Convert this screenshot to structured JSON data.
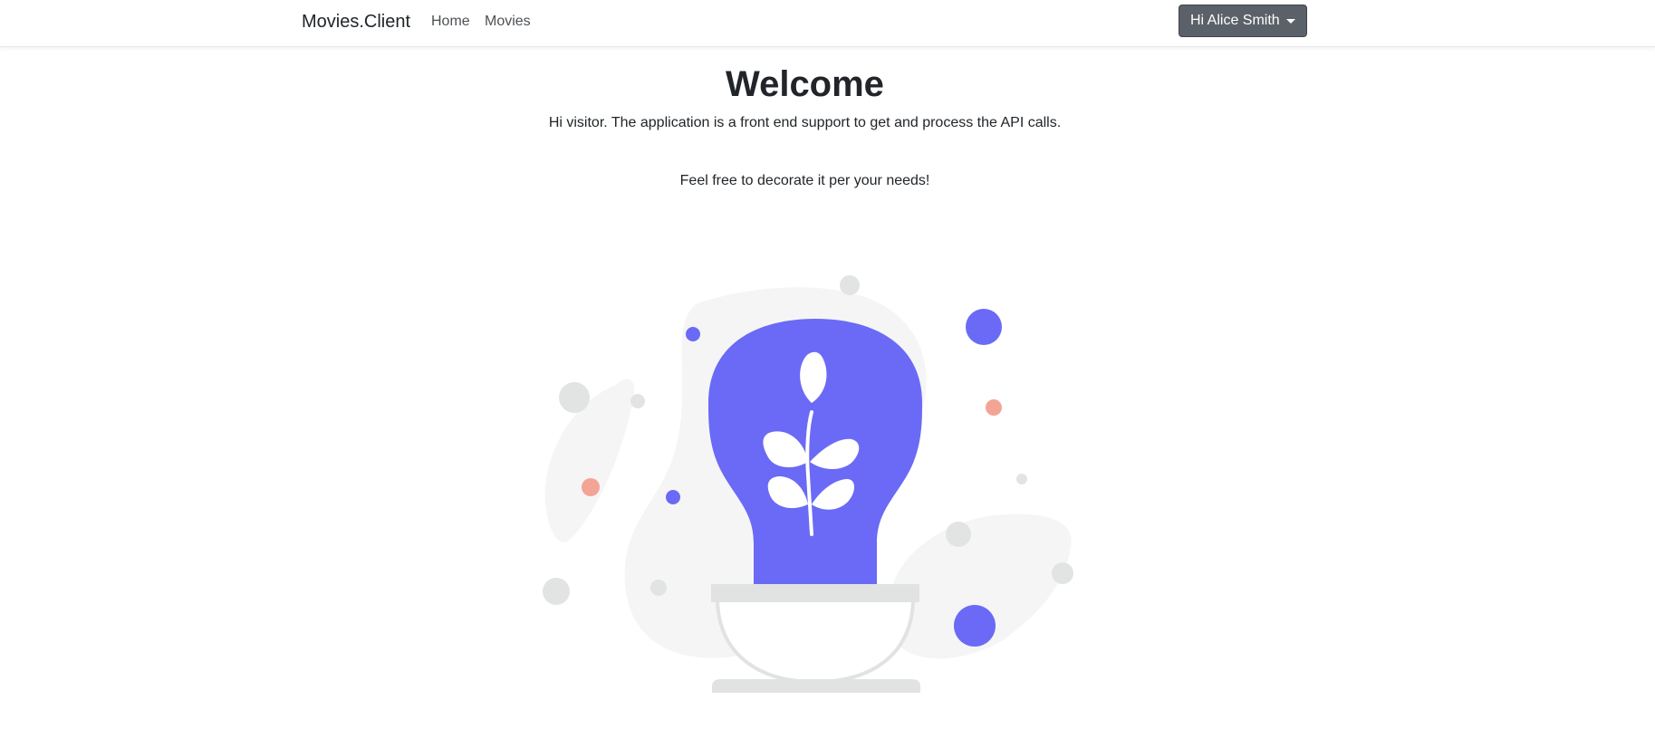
{
  "navbar": {
    "brand": "Movies.Client",
    "links": [
      {
        "label": "Home"
      },
      {
        "label": "Movies"
      }
    ],
    "user_menu_label": "Hi Alice Smith"
  },
  "main": {
    "title": "Welcome",
    "intro": "Hi visitor. The application is a front end support to get and process the API calls.",
    "note": "Feel free to decorate it per your needs!"
  },
  "illustration": {
    "name": "plant-lightbulb-illustration",
    "colors": {
      "accent": "#6a6af6",
      "blob": "#f5f5f5",
      "dot_gray": "#e2e4e4",
      "dot_salmon": "#f2a595",
      "pot": "#e1e3e3",
      "leaf": "#ffffff"
    }
  }
}
